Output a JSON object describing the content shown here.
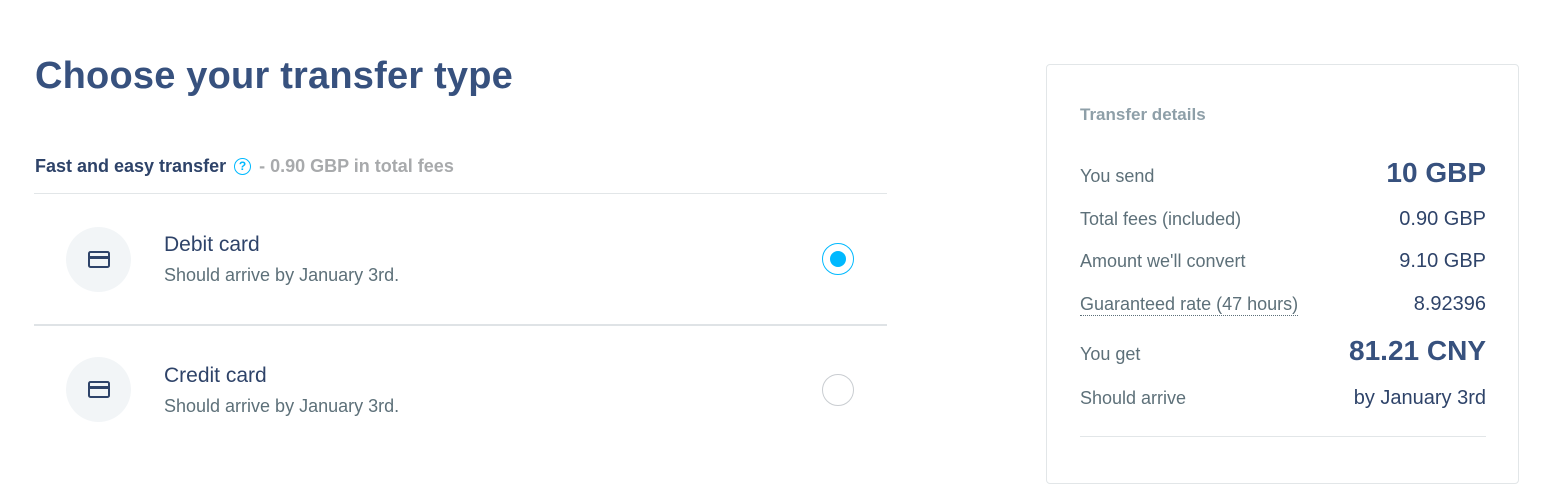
{
  "page": {
    "title": "Choose your transfer type"
  },
  "section": {
    "title": "Fast and easy transfer",
    "help_icon": "question-circle-icon",
    "fees_text": "- 0.90 GBP in total fees"
  },
  "options": [
    {
      "icon": "card-icon",
      "title": "Debit card",
      "subtitle": "Should arrive by January 3rd.",
      "selected": true
    },
    {
      "icon": "card-icon",
      "title": "Credit card",
      "subtitle": "Should arrive by January 3rd.",
      "selected": false
    }
  ],
  "details": {
    "heading": "Transfer details",
    "send_label": "You send",
    "send_value": "10 GBP",
    "fees_label": "Total fees (included)",
    "fees_value": "0.90 GBP",
    "convert_label": "Amount we'll convert",
    "convert_value": "9.10 GBP",
    "rate_label": "Guaranteed rate (47 hours)",
    "rate_value": "8.92396",
    "get_label": "You get",
    "get_value": "81.21 CNY",
    "arrive_label": "Should arrive",
    "arrive_value": "by January 3rd"
  },
  "colors": {
    "accent": "#00b9ff",
    "heading": "#37517e",
    "text": "#2e4369",
    "muted": "#5d7079",
    "fees_muted": "#a8aaac"
  }
}
